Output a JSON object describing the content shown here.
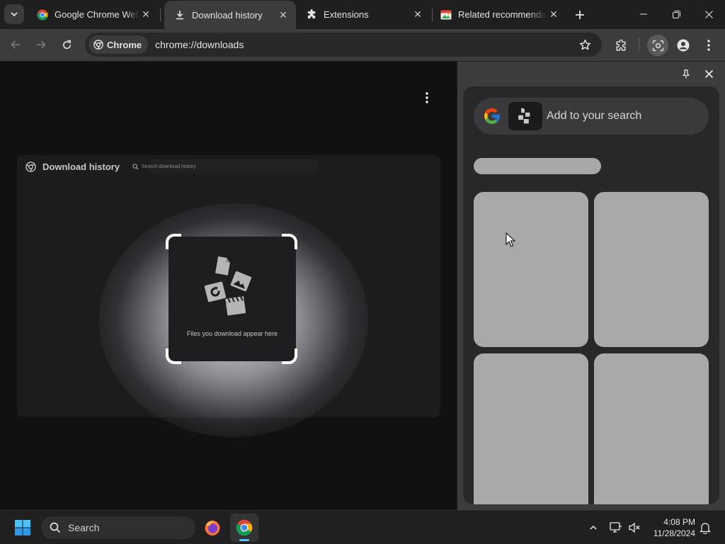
{
  "tabs": [
    {
      "title": "Google Chrome Web Store",
      "icon": "chrome-icon",
      "active": false
    },
    {
      "title": "Download history",
      "icon": "download-icon",
      "active": true
    },
    {
      "title": "Extensions",
      "icon": "puzzle-icon",
      "active": false
    },
    {
      "title": "Related recommendations",
      "icon": "image-icon",
      "active": false
    }
  ],
  "omnibox": {
    "chip_label": "Chrome",
    "url": "chrome://downloads"
  },
  "page": {
    "title": "Download history",
    "search_placeholder": "Search download history",
    "empty_message": "Files you download appear here"
  },
  "side_panel": {
    "add_search_label": "Add to your search"
  },
  "taskbar": {
    "search_label": "Search",
    "time": "4:08 PM",
    "date": "11/28/2024"
  },
  "colors": {
    "tab_strip": "#1f1f1f",
    "toolbar": "#3c3c3c",
    "content_bg": "#111111",
    "skeleton": "#a9a9a9",
    "chrome_blue": "#4285f4",
    "chrome_red": "#ea4335",
    "chrome_yellow": "#fbbc05",
    "chrome_green": "#34a853"
  }
}
